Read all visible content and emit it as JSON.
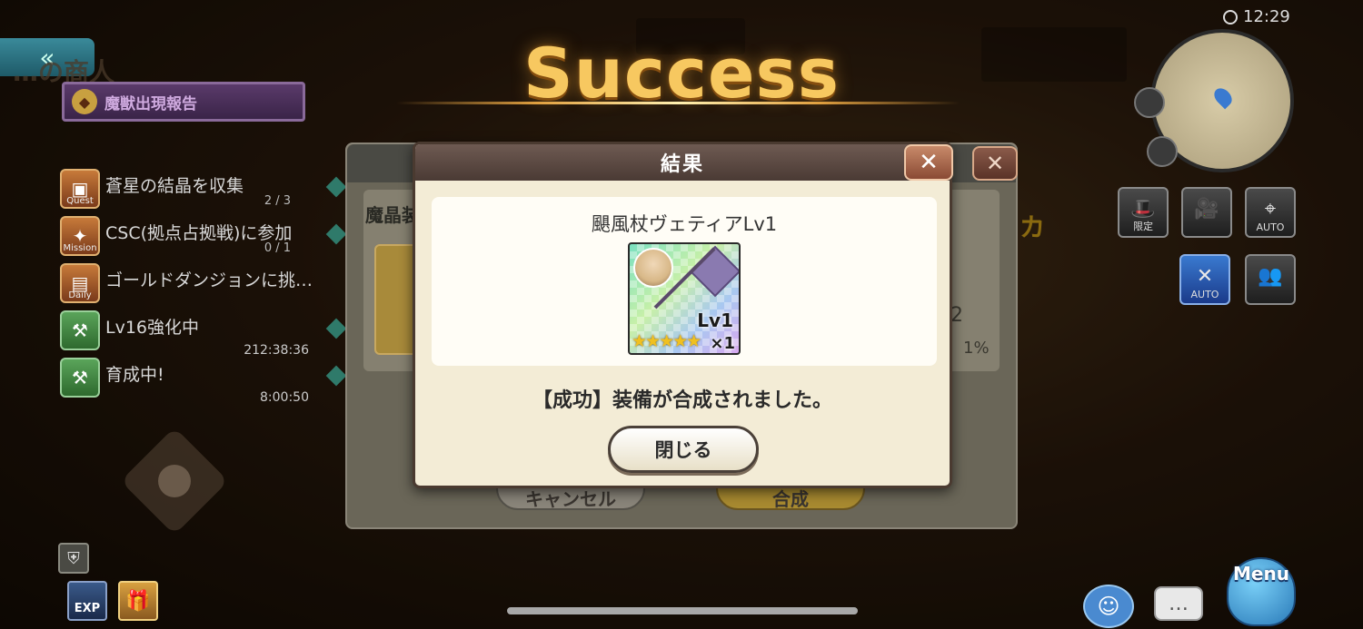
{
  "header": {
    "success_title": "Success",
    "npc_name": "…の商人",
    "report_label": "魔獣出現報告",
    "back_glyph": "«",
    "clock": "12:29"
  },
  "quests": [
    {
      "tag": "Quest",
      "label": "蒼星の結晶を収集",
      "count": "2 / 3",
      "timer": ""
    },
    {
      "tag": "Mission",
      "label": "CSC(拠点占拠戦)に参加",
      "count": "0 / 1",
      "timer": ""
    },
    {
      "tag": "Daily",
      "label": "ゴールドダンジョンに挑…",
      "count": "",
      "timer": ""
    },
    {
      "tag": "",
      "label": "Lv16強化中",
      "count": "",
      "timer": "212:38:36"
    },
    {
      "tag": "",
      "label": "育成中!",
      "count": "",
      "timer": "8:00:50"
    }
  ],
  "right_buttons": [
    {
      "label": "限定",
      "icon": "hat-icon"
    },
    {
      "label": "",
      "icon": "camera-icon"
    },
    {
      "label": "AUTO",
      "icon": "auto-target-icon"
    },
    {
      "label": "AUTO",
      "icon": "auto-skill-icon"
    },
    {
      "label": "",
      "icon": "party-icon"
    }
  ],
  "background_panel": {
    "section_label": "魔晶装",
    "right_fragment": "カ",
    "stat_value": "2",
    "stat_percent": "1%",
    "cancel_label": "キャンセル",
    "confirm_label": "合成"
  },
  "dialog": {
    "title": "結果",
    "close_glyph": "✕",
    "item_name": "颶風杖ヴェティアLv1",
    "item_level": "Lv1",
    "item_stars": "★★★★★",
    "item_quantity": "×1",
    "message": "【成功】装備が合成されました。",
    "close_button": "閉じる"
  },
  "bottom": {
    "exp_label": "EXP",
    "menu_label": "Menu"
  },
  "colors": {
    "success_gold": "#f7c860",
    "dialog_bg": "#f3ecd6",
    "dialog_header": "#5a4a42",
    "close_red": "#a85a44"
  }
}
